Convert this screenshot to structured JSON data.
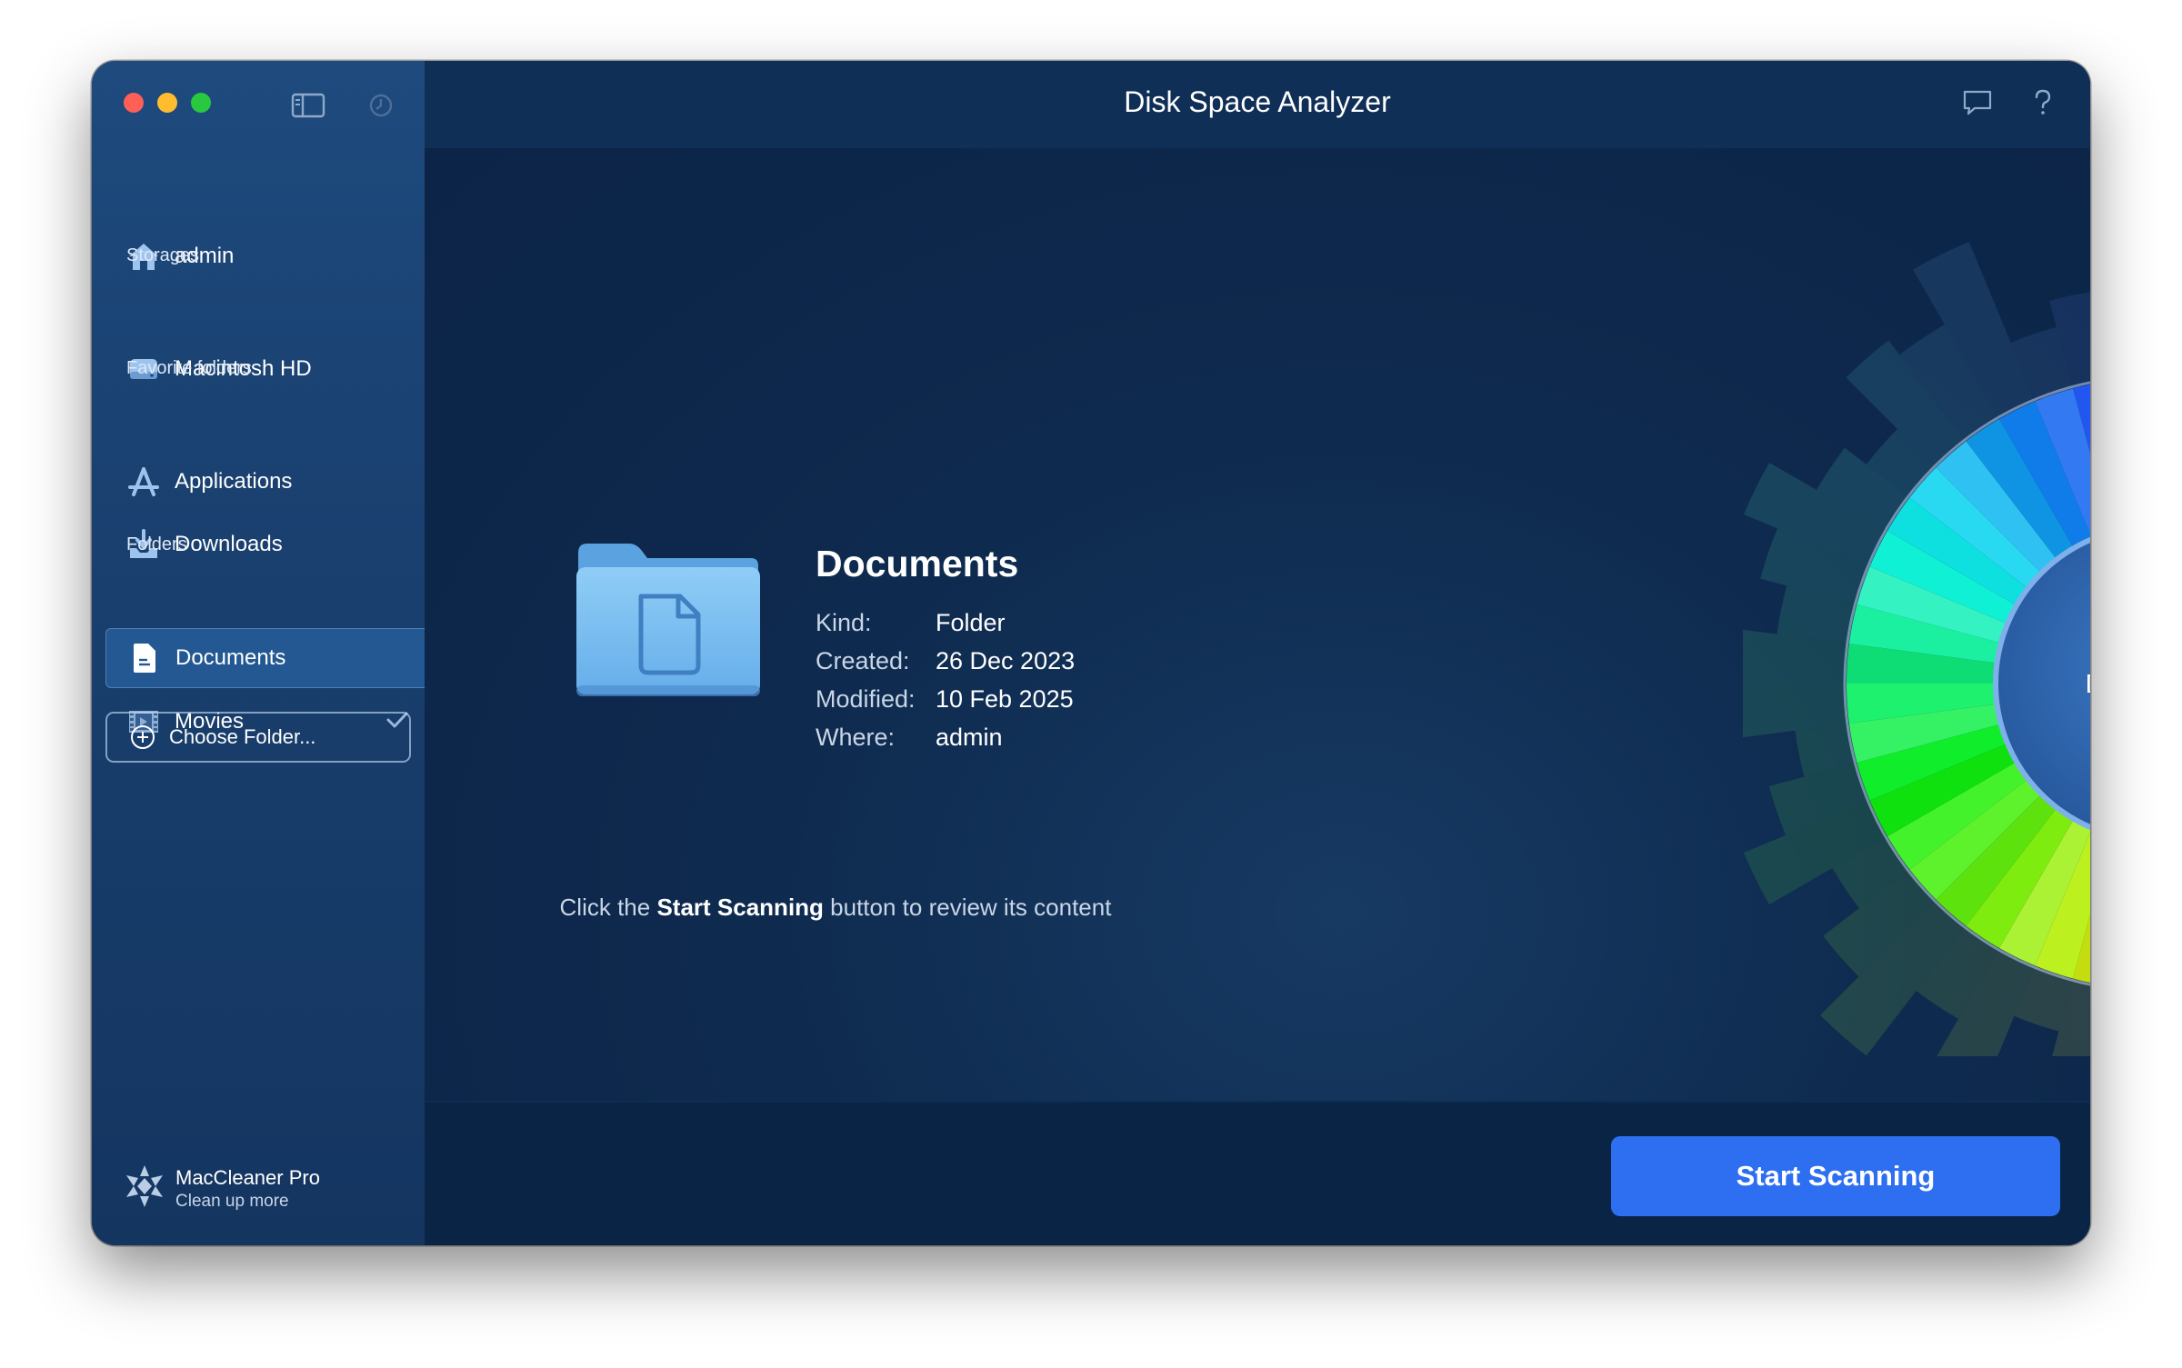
{
  "window": {
    "title": "Disk Space Analyzer"
  },
  "sidebar": {
    "home": {
      "label": "admin"
    },
    "storages_header": "Storages",
    "storages": [
      {
        "label": "Macintosh HD"
      }
    ],
    "favorites_header": "Favorite folders",
    "favorites": [
      {
        "label": "Applications"
      },
      {
        "label": "Downloads"
      }
    ],
    "folders_header": "Folders",
    "folders": [
      {
        "label": "Documents",
        "selected": true
      },
      {
        "label": "Movies",
        "checked": true
      }
    ],
    "choose_folder_label": "Choose Folder...",
    "brand": {
      "name": "MacCleaner Pro",
      "tagline": "Clean up more"
    }
  },
  "details": {
    "name": "Documents",
    "kind_label": "Kind:",
    "kind": "Folder",
    "created_label": "Created:",
    "created": "26 Dec 2023",
    "modified_label": "Modified:",
    "modified": "10 Feb 2025",
    "where_label": "Where:",
    "where": "admin"
  },
  "hint": {
    "prefix": "Click the ",
    "emphasis": "Start Scanning",
    "suffix": " button to review its content"
  },
  "sunburst": {
    "center_label": "Documents",
    "segments": 48
  },
  "footer": {
    "start_label": "Start Scanning"
  },
  "colors": {
    "accent": "#2d6ff0",
    "sidebar": "#1e4a7e",
    "background": "#0c2546"
  }
}
